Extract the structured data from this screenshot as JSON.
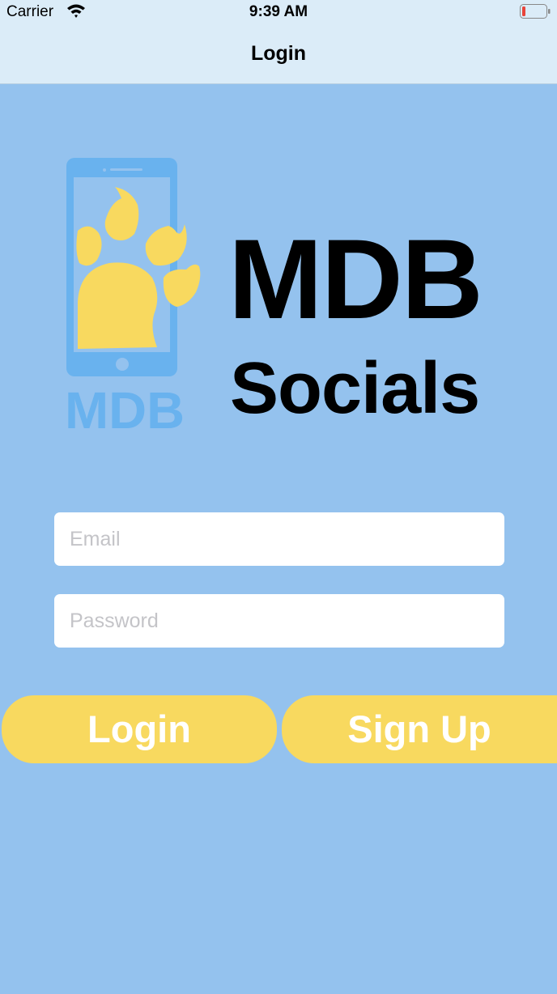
{
  "status_bar": {
    "carrier": "Carrier",
    "time": "9:39 AM",
    "wifi_icon": "wifi-icon",
    "battery_icon": "battery-low-icon"
  },
  "nav": {
    "title": "Login"
  },
  "logo": {
    "icon": "phone-paw-logo-icon",
    "logo_text": "MDB",
    "colors": {
      "phone": "#69b2ee",
      "paw": "#f8d95f"
    }
  },
  "brand": {
    "line1": "MDB",
    "line2": "Socials"
  },
  "form": {
    "email_placeholder": "Email",
    "email_value": "",
    "password_placeholder": "Password",
    "password_value": ""
  },
  "buttons": {
    "login": "Login",
    "signup": "Sign Up"
  },
  "colors": {
    "background": "#94c2ee",
    "nav_background": "#dbecf8",
    "button": "#f8d95f",
    "battery_level": "#e8443a"
  }
}
